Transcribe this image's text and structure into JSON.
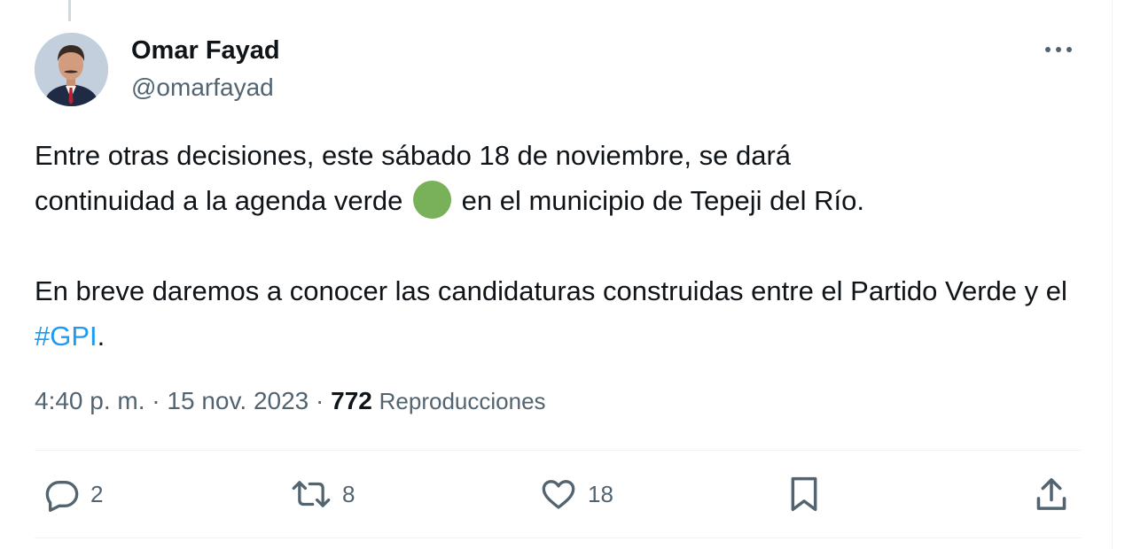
{
  "author": {
    "display_name": "Omar Fayad",
    "handle": "@omarfayad"
  },
  "tweet": {
    "line1": "Entre otras decisiones, este sábado 18 de noviembre, se dará",
    "line2_before": "continuidad a la agenda verde",
    "line2_after": "en el municipio de Tepeji del Río.",
    "para2_text": "En breve daremos a conocer las candidaturas construidas entre el Partido Verde y el",
    "hashtag": "#GPI",
    "para2_end": "."
  },
  "meta": {
    "time": "4:40 p. m.",
    "separator": "·",
    "date": "15 nov. 2023",
    "views_count": "772",
    "views_label": "Reproducciones"
  },
  "actions": {
    "replies": "2",
    "retweets": "8",
    "likes": "18"
  },
  "icons": {
    "more": "more-horizontal-icon",
    "reply": "reply-icon",
    "retweet": "retweet-icon",
    "like": "heart-icon",
    "bookmark": "bookmark-icon",
    "share": "share-icon",
    "emoji": "green-circle-emoji"
  },
  "colors": {
    "text": "#0f1419",
    "secondary": "#536471",
    "link": "#1d9bf0",
    "green_circle": "#78b159"
  }
}
